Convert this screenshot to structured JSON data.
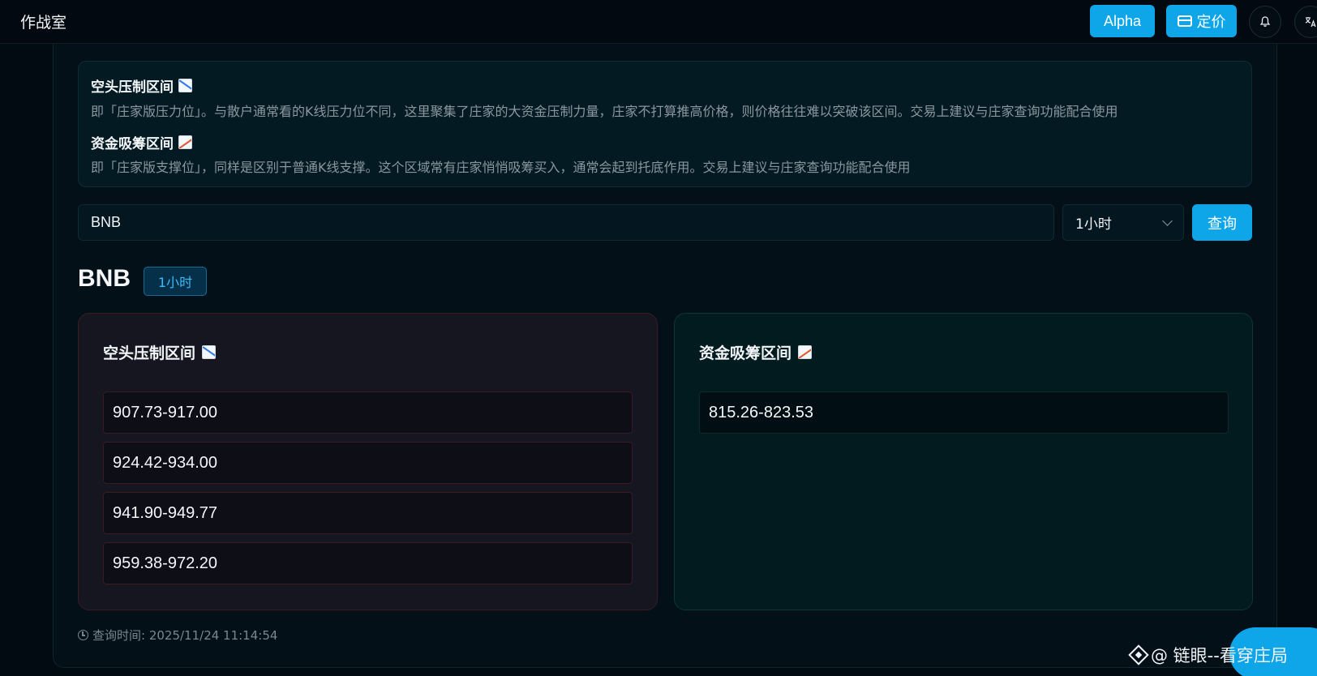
{
  "app": {
    "title": "作战室"
  },
  "header": {
    "alpha_label": "Alpha",
    "pricing_label": "定价",
    "bell_icon": "bell-icon",
    "translate_icon": "translate-icon"
  },
  "info": {
    "resistance_title": "空头压制区间",
    "resistance_desc": "即「庄家版压力位」。与散户通常看的K线压力位不同，这里聚集了庄家的大资金压制力量，庄家不打算推高价格，则价格往往难以突破该区间。交易上建议与庄家查询功能配合使用",
    "support_title": "资金吸筹区间",
    "support_desc": "即「庄家版支撑位」，同样是区别于普通K线支撑。这个区域常有庄家悄悄吸筹买入，通常会起到托底作用。交易上建议与庄家查询功能配合使用"
  },
  "search": {
    "value": "BNB",
    "interval": "1小时",
    "query_label": "查询"
  },
  "result": {
    "symbol": "BNB",
    "interval_badge": "1小时",
    "resistance": {
      "title": "空头压制区间",
      "ranges": [
        "907.73-917.00",
        "924.42-934.00",
        "941.90-949.77",
        "959.38-972.20"
      ]
    },
    "support": {
      "title": "资金吸筹区间",
      "ranges": [
        "815.26-823.53"
      ]
    },
    "query_time": "查询时间: 2025/11/24 11:14:54"
  },
  "watermark": {
    "text": "@ 链眼--看穿庄局"
  },
  "colors": {
    "accent": "#0ea5e9",
    "background": "#020a12",
    "resistance_border": "#3b1c26",
    "support_border": "#0a3634"
  }
}
